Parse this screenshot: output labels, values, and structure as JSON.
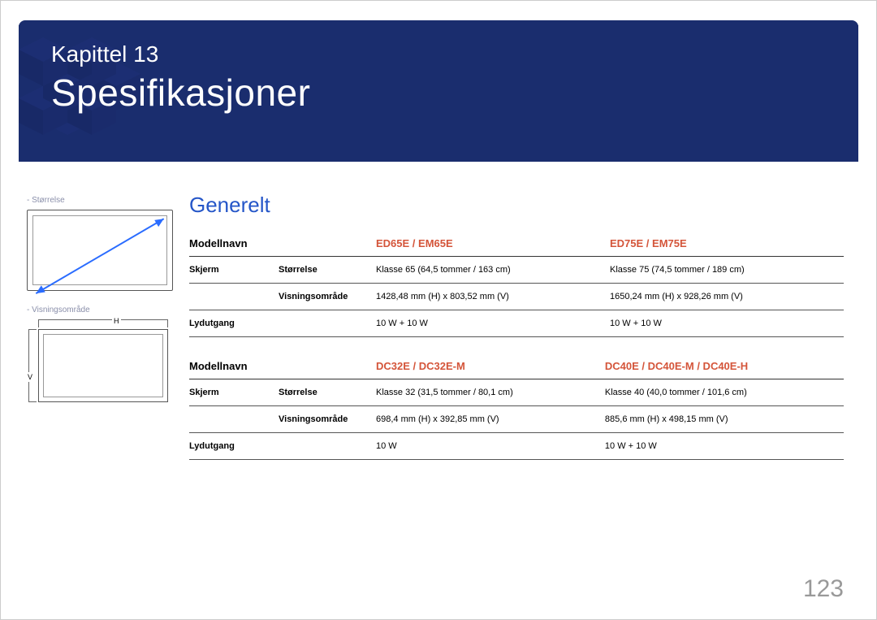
{
  "chapter": "Kapittel 13",
  "title": "Spesifikasjoner",
  "section": "Generelt",
  "pagenum": "123",
  "sidebar": {
    "size_label": "Størrelse",
    "view_label": "Visningsområde",
    "h": "H",
    "v": "V"
  },
  "tables": [
    {
      "head": {
        "col0": "Modellnavn",
        "col1": "ED65E / EM65E",
        "col2": "ED75E / EM75E"
      },
      "rows": [
        {
          "cat": "Skjerm",
          "sub": "Størrelse",
          "c1": "Klasse 65 (64,5 tommer / 163 cm)",
          "c2": "Klasse 75 (74,5 tommer / 189 cm)"
        },
        {
          "cat": "",
          "sub": "Visningsområde",
          "c1": "1428,48 mm (H) x 803,52 mm (V)",
          "c2": "1650,24 mm (H) x 928,26 mm (V)"
        },
        {
          "cat": "Lydutgang",
          "sub": "",
          "c1": "10 W + 10 W",
          "c2": "10 W + 10 W"
        }
      ]
    },
    {
      "head": {
        "col0": "Modellnavn",
        "col1": "DC32E / DC32E-M",
        "col2": "DC40E / DC40E-M / DC40E-H"
      },
      "rows": [
        {
          "cat": "Skjerm",
          "sub": "Størrelse",
          "c1": "Klasse 32 (31,5 tommer / 80,1 cm)",
          "c2": "Klasse 40 (40,0 tommer / 101,6 cm)"
        },
        {
          "cat": "",
          "sub": "Visningsområde",
          "c1": "698,4 mm (H) x 392,85 mm (V)",
          "c2": "885,6 mm (H) x 498,15 mm (V)"
        },
        {
          "cat": "Lydutgang",
          "sub": "",
          "c1": "10 W",
          "c2": "10 W + 10 W"
        }
      ]
    }
  ]
}
